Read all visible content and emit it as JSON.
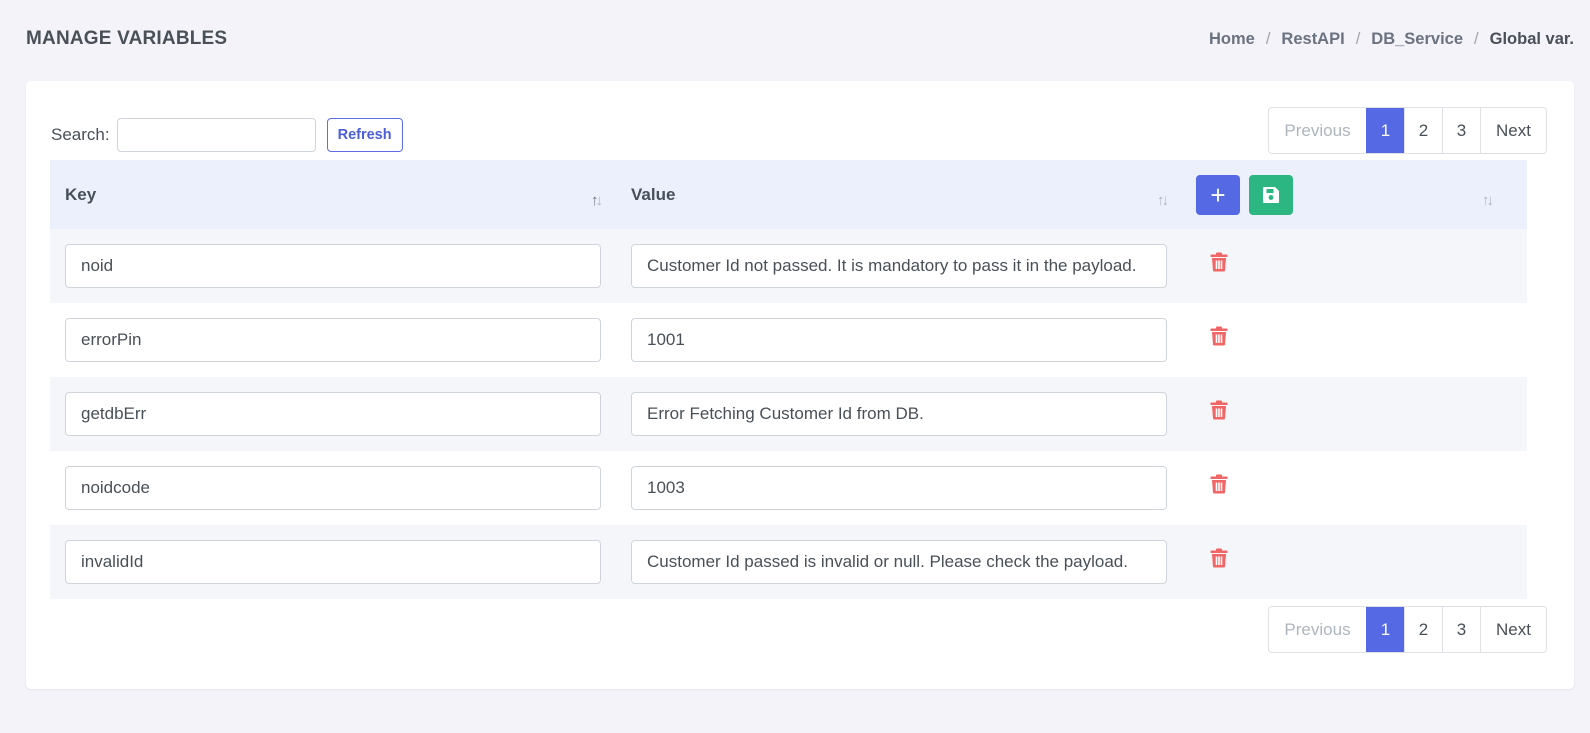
{
  "header": {
    "title": "MANAGE VARIABLES",
    "breadcrumb": [
      "Home",
      "RestAPI",
      "DB_Service",
      "Global var."
    ],
    "separator": "/"
  },
  "toolbar": {
    "search_label": "Search:",
    "search_value": "",
    "search_placeholder": "",
    "refresh_label": "Refresh"
  },
  "pagination": {
    "previous_label": "Previous",
    "pages": [
      "1",
      "2",
      "3"
    ],
    "active_page": "1",
    "next_label": "Next"
  },
  "table": {
    "columns": {
      "key": "Key",
      "value": "Value"
    },
    "add_icon": "plus-icon",
    "save_icon": "save-icon",
    "delete_icon": "trash-icon",
    "rows": [
      {
        "key": "noid",
        "value": "Customer Id not passed. It is mandatory to pass it in the payload."
      },
      {
        "key": "errorPin",
        "value": "1001"
      },
      {
        "key": "getdbErr",
        "value": "Error Fetching Customer Id from DB."
      },
      {
        "key": "noidcode",
        "value": "1003"
      },
      {
        "key": "invalidId",
        "value": "Customer Id passed is invalid or null. Please check the payload."
      }
    ]
  },
  "colors": {
    "primary": "#5569e4",
    "success": "#2bb682",
    "danger": "#f06565",
    "header_bg": "#ebf0fc",
    "row_stripe": "#f5f6f9"
  }
}
